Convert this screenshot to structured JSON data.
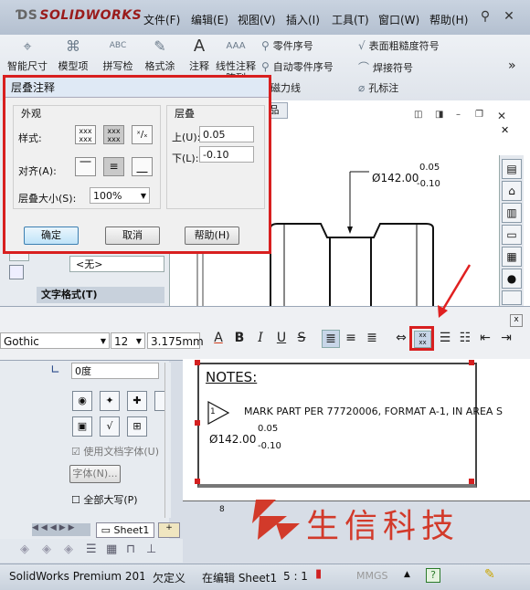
{
  "app": {
    "logo": "SOLIDWORKS",
    "menus": [
      "文件(F)",
      "编辑(E)",
      "视图(V)",
      "插入(I)",
      "工具(T)",
      "窗口(W)",
      "帮助(H)"
    ]
  },
  "ribbon": {
    "big": [
      {
        "label": "智能尺寸",
        "icon": "smart-dimension-icon"
      },
      {
        "label": "模型项",
        "icon": "model-items-icon"
      },
      {
        "label": "拼写检",
        "icon": "spell-check-icon"
      },
      {
        "label": "格式涂",
        "icon": "format-painter-icon"
      },
      {
        "label": "注释",
        "icon": "note-icon"
      },
      {
        "label": "线性注释阵列",
        "icon": "linear-note-pattern-icon"
      }
    ],
    "small": [
      "零件序号",
      "自动零件序号",
      "磁力线",
      "表面粗糙度符号",
      "焊接符号",
      "孔标注"
    ],
    "more": "»"
  },
  "dialog": {
    "title": "层叠注释",
    "appearance_group": "外观",
    "style_label": "样式:",
    "align_label": "对齐(A):",
    "size_label": "层叠大小(S):",
    "size_value": "100%",
    "stack_group": "层叠",
    "upper_label": "上(U):",
    "upper_value": "0.05",
    "lower_label": "下(L):",
    "lower_value": "-0.10",
    "ok": "确定",
    "cancel": "取消",
    "help": "帮助(H)"
  },
  "drawing": {
    "view_tab": "品",
    "dimension": "Ø142.00",
    "upper": "0.05",
    "lower": "-0.10"
  },
  "leftpane": {
    "none_option": "<无>",
    "text_format": "文字格式(T)",
    "angle": "0度",
    "use_doc_font": "使用文档字体(U)",
    "font_button": "字体(N)...",
    "all_caps": "全部大写(P)",
    "sheet_tab": "Sheet1"
  },
  "formatbar": {
    "font": "Gothic",
    "size": "12",
    "height": "3.175mm",
    "close": "x"
  },
  "notes": {
    "heading": "NOTES:",
    "flag": "1",
    "line1": "MARK PART PER 77720006, FORMAT A-1, IN AREA S",
    "dimension": "Ø142.00",
    "upper": "0.05",
    "lower": "-0.10",
    "ruler_mark": "8"
  },
  "watermark": {
    "text": "生信科技"
  },
  "status": {
    "product": "SolidWorks Premium 201",
    "undefined": "欠定义",
    "editing": "在编辑 Sheet1",
    "scale": "5 : 1",
    "units": "MMGS",
    "help": "?"
  },
  "colors": {
    "highlight": "#d81f1f",
    "logo": "#9a1b1b",
    "watermark": "#d23a2a"
  }
}
